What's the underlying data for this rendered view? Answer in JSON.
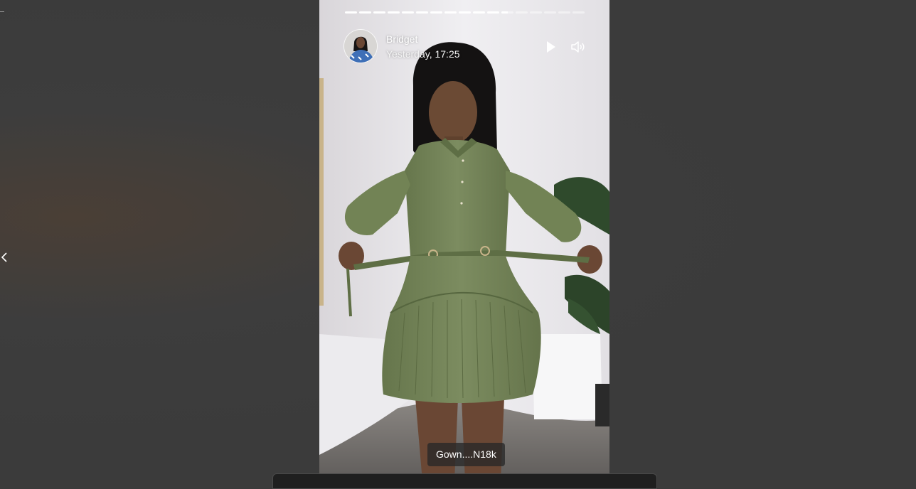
{
  "story": {
    "author_name": "Bridget",
    "timestamp": "Yesterday, 17:25",
    "caption": "Gown....N18k",
    "segments_total": 17,
    "segments_viewed": 11,
    "current_segment_progress": 0.5
  },
  "icons": {
    "play": "play-icon",
    "sound": "speaker-icon",
    "previous": "chevron-left-icon"
  },
  "colors": {
    "backdrop": "#3b3b3b",
    "dress": "#6f7f55",
    "caption_bg": "#282828"
  }
}
